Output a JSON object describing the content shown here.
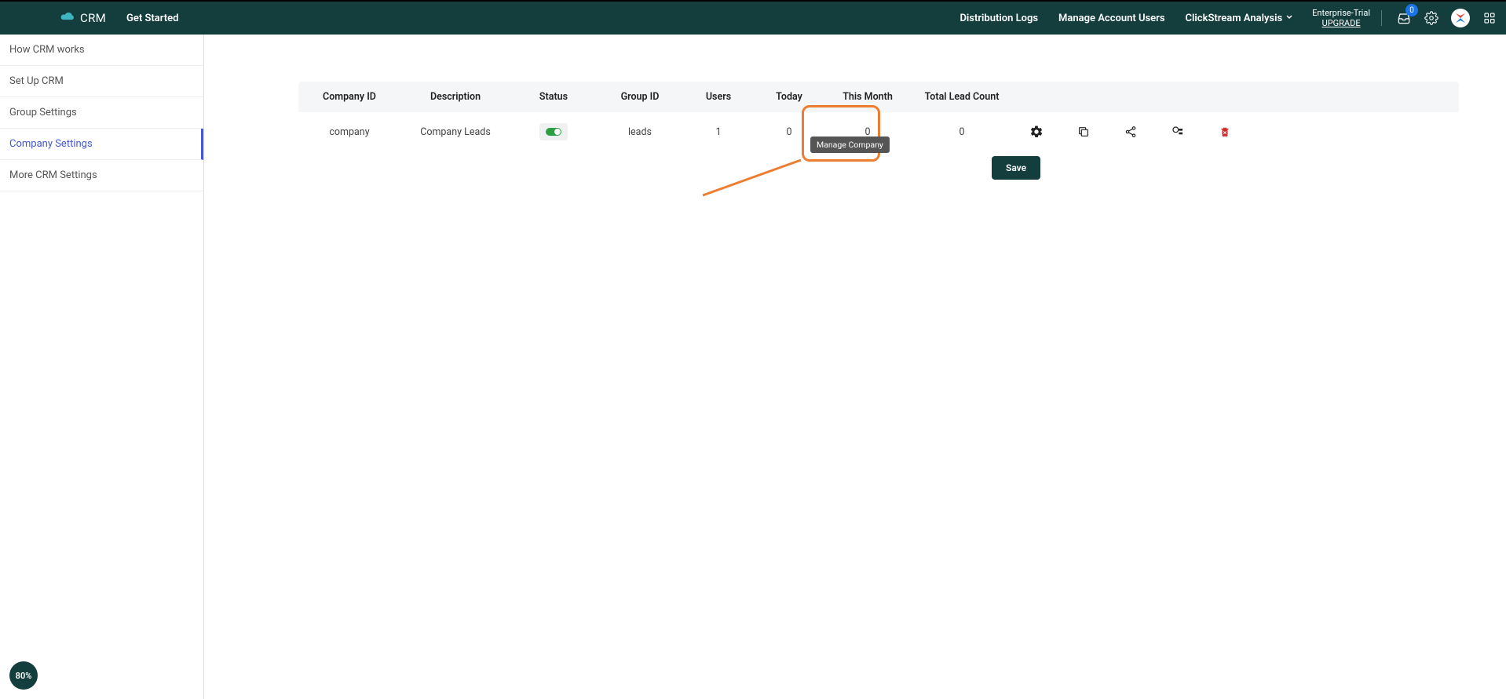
{
  "header": {
    "logo_text": "CRM",
    "get_started": "Get Started",
    "nav": {
      "distribution_logs": "Distribution Logs",
      "manage_account_users": "Manage Account Users",
      "clickstream": "ClickStream Analysis"
    },
    "trial": {
      "label": "Enterprise-Trial",
      "upgrade": "UPGRADE"
    },
    "badge_count": "0"
  },
  "sidebar": {
    "items": [
      {
        "label": "How CRM works"
      },
      {
        "label": "Set Up CRM"
      },
      {
        "label": "Group Settings"
      },
      {
        "label": "Company Settings"
      },
      {
        "label": "More CRM Settings"
      }
    ],
    "active_index": 3
  },
  "table": {
    "headers": {
      "company_id": "Company ID",
      "description": "Description",
      "status": "Status",
      "group_id": "Group ID",
      "users": "Users",
      "today": "Today",
      "this_month": "This Month",
      "total_lead_count": "Total Lead Count"
    },
    "row": {
      "company_id": "company",
      "description": "Company Leads",
      "group_id": "leads",
      "users": "1",
      "today": "0",
      "this_month": "0",
      "total_lead_count": "0"
    }
  },
  "tooltip": {
    "manage_company": "Manage Company"
  },
  "buttons": {
    "save": "Save"
  },
  "progress": {
    "value": "80%"
  }
}
